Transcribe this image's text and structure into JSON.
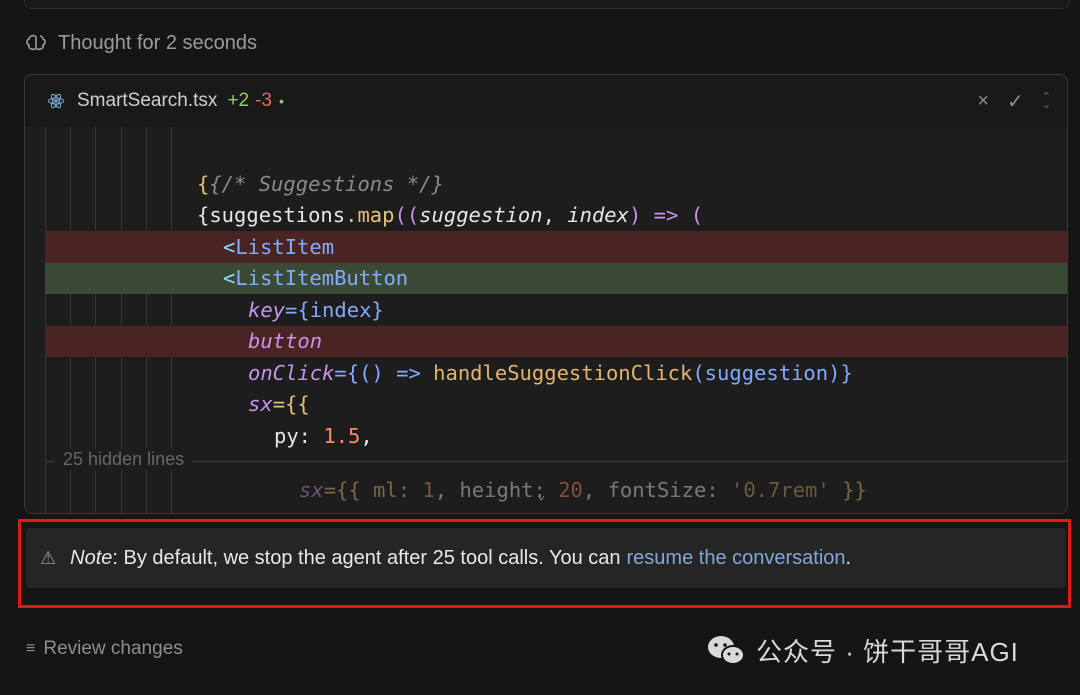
{
  "thought": {
    "text": "Thought for 2 seconds",
    "icon": "brain-icon"
  },
  "file": {
    "name": "SmartSearch.tsx",
    "added": "+2",
    "removed": "-3",
    "status_dot": "•",
    "actions": {
      "close": "×",
      "accept": "✓",
      "expand": "⌃⌄"
    }
  },
  "code": {
    "l1": "{/* Suggestions */}",
    "l2_a": "{suggestions",
    "l2_b": ".map",
    "l2_c": "((",
    "l2_d": "suggestion",
    "l2_e": ", ",
    "l2_f": "index",
    "l2_g": ") => (",
    "l3_lt": "<",
    "l3_tag": "ListItem",
    "l4_lt": "<",
    "l4_tag": "ListItemButton",
    "l5_attr": "key",
    "l5_rest": "={index}",
    "l6_attr": "button",
    "l7_attr": "onClick",
    "l7_a": "={() => ",
    "l7_fn": "handleSuggestionClick",
    "l7_b": "(suggestion)}",
    "l8_attr": "sx",
    "l8_rest": "={{",
    "l9_key": "py: ",
    "l9_num": "1.5",
    "l9_end": ",",
    "hidden_lines": "25 hidden lines",
    "l10_attr": "sx",
    "l10_a": "={{ ml: ",
    "l10_n1": "1",
    "l10_b": ", height: ",
    "l10_n2": "20",
    "l10_c": ", fontSize: ",
    "l10_str": "'0.7rem'",
    "l10_d": " }}"
  },
  "note": {
    "label": "Note",
    "text": ": By default, we stop the agent after 25 tool calls. You can",
    "link": "resume the conversation",
    "end": "."
  },
  "review": {
    "label": "Review changes"
  },
  "watermark": {
    "text": "公众号 · 饼干哥哥AGI"
  },
  "colors": {
    "highlight_border": "#e01818",
    "deleted_bg": "#4a2323",
    "added_bg": "#3a4a34",
    "link": "#7fa8d8"
  }
}
